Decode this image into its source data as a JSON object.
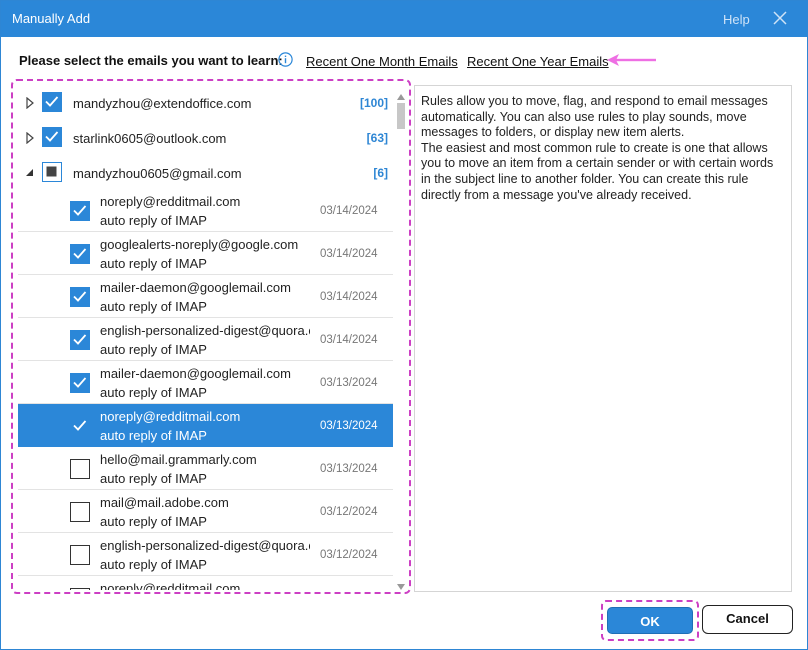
{
  "window": {
    "title": "Manually Add",
    "help_label": "Help"
  },
  "prompt": {
    "text": "Please select the emails you want to learn:",
    "link_month": "Recent One Month Emails",
    "link_year": "Recent One Year Emails"
  },
  "accounts": [
    {
      "name": "mandyzhou@extendoffice.com",
      "count": "[100]",
      "state": "checked",
      "expanded": false
    },
    {
      "name": "starlink0605@outlook.com",
      "count": "[63]",
      "state": "checked",
      "expanded": false
    },
    {
      "name": "mandyzhou0605@gmail.com",
      "count": "[6]",
      "state": "partial",
      "expanded": true
    }
  ],
  "emails": [
    {
      "from": "noreply@redditmail.com",
      "subject": "auto reply of IMAP",
      "date": "03/14/2024",
      "checked": true,
      "selected": false
    },
    {
      "from": "googlealerts-noreply@google.com",
      "subject": "auto reply of IMAP",
      "date": "03/14/2024",
      "checked": true,
      "selected": false
    },
    {
      "from": "mailer-daemon@googlemail.com",
      "subject": "auto reply of IMAP",
      "date": "03/14/2024",
      "checked": true,
      "selected": false
    },
    {
      "from": "english-personalized-digest@quora.com",
      "subject": "auto reply of IMAP",
      "date": "03/14/2024",
      "checked": true,
      "selected": false
    },
    {
      "from": "mailer-daemon@googlemail.com",
      "subject": "auto reply of IMAP",
      "date": "03/13/2024",
      "checked": true,
      "selected": false
    },
    {
      "from": "noreply@redditmail.com",
      "subject": "auto reply of IMAP",
      "date": "03/13/2024",
      "checked": true,
      "selected": true
    },
    {
      "from": "hello@mail.grammarly.com",
      "subject": "auto reply of IMAP",
      "date": "03/13/2024",
      "checked": false,
      "selected": false
    },
    {
      "from": "mail@mail.adobe.com",
      "subject": "auto reply of IMAP",
      "date": "03/12/2024",
      "checked": false,
      "selected": false
    },
    {
      "from": "english-personalized-digest@quora.com",
      "subject": "auto reply of IMAP",
      "date": "03/12/2024",
      "checked": false,
      "selected": false
    },
    {
      "from": "noreply@redditmail.com",
      "subject": "",
      "date": "",
      "checked": false,
      "selected": false
    }
  ],
  "description": {
    "p1": "Rules allow you to move, flag, and respond to email messages automatically. You can also use rules to play sounds, move messages to folders, or display new item alerts.",
    "p2": "The easiest and most common rule to create is one that allows you to move an item from a certain sender or with certain words in the subject line to another folder. You can create this rule directly from a message you've already received."
  },
  "buttons": {
    "ok": "OK",
    "cancel": "Cancel"
  },
  "colors": {
    "accent": "#2b87d8",
    "highlight": "#cc3fc4"
  }
}
